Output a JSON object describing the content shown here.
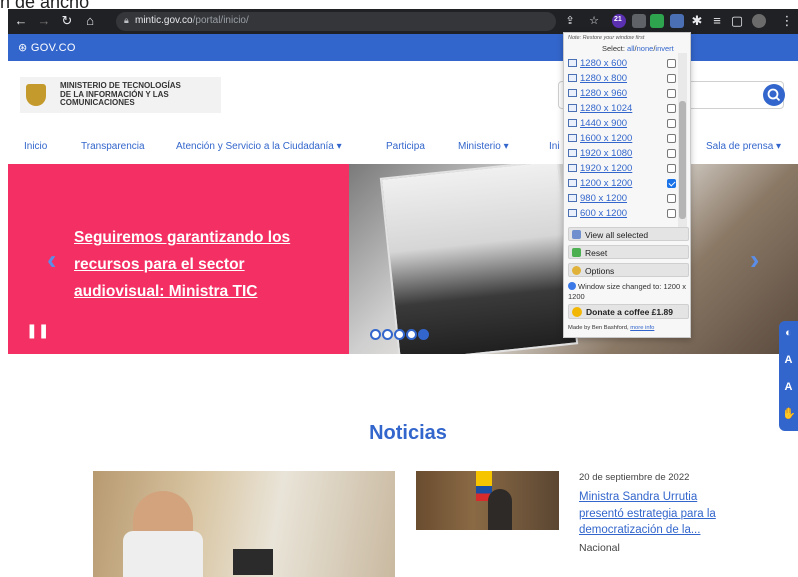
{
  "top_clip": "n de ancho",
  "browser": {
    "url_domain": "mintic.gov.co",
    "url_path": "/portal/inicio/",
    "extension_badge": "21"
  },
  "gov_bar": {
    "logo_text": "GOV.CO"
  },
  "header": {
    "ministry_line1": "MINISTERIO DE TECNOLOGÍAS",
    "ministry_line2": "DE LA INFORMACIÓN Y LAS",
    "ministry_line3": "COMUNICACIONES"
  },
  "nav": {
    "items": [
      {
        "label": "Inicio"
      },
      {
        "label": "Transparencia"
      },
      {
        "label": "Atención y Servicio a la Ciudadanía ▾"
      },
      {
        "label": "Participa"
      },
      {
        "label": "Ministerio ▾"
      },
      {
        "label": "Ini"
      },
      {
        "label": "Sala de prensa ▾"
      }
    ]
  },
  "hero": {
    "title": "Seguiremos garantizando los recursos para el sector audiovisual: Ministra TIC",
    "slide_count": 5,
    "active_slide": 5
  },
  "news": {
    "section_title": "Noticias",
    "item": {
      "date": "20 de septiembre de 2022",
      "headline": "Ministra Sandra Urrutia presentó estrategia para la democratización de la...",
      "category": "Nacional"
    }
  },
  "popup": {
    "note": "Note: Restore your window first",
    "select_label": "Select:",
    "select_all": "all",
    "select_none": "none",
    "select_invert": "invert",
    "resolutions": [
      {
        "label": "1280 x 600",
        "checked": false
      },
      {
        "label": "1280 x 800",
        "checked": false
      },
      {
        "label": "1280 x 960",
        "checked": false
      },
      {
        "label": "1280 x 1024",
        "checked": false
      },
      {
        "label": "1440 x 900",
        "checked": false
      },
      {
        "label": "1600 x 1200",
        "checked": false
      },
      {
        "label": "1920 x 1080",
        "checked": false
      },
      {
        "label": "1920 x 1200",
        "checked": false
      },
      {
        "label": "1200 x 1200",
        "checked": true
      },
      {
        "label": "980 x 1200",
        "checked": false
      },
      {
        "label": "600 x 1200",
        "checked": false
      }
    ],
    "view_all_label": "View all selected",
    "reset_label": "Reset",
    "options_label": "Options",
    "status_message": "Window size changed to: 1200 x 1200",
    "donate_label": "Donate a coffee £1.89",
    "credit_prefix": "Made by Ben Bashford,",
    "credit_link": "more info"
  },
  "colors": {
    "gov_blue": "#3366cc",
    "hero_pink": "#f42f63",
    "chrome_dark": "#202124"
  }
}
